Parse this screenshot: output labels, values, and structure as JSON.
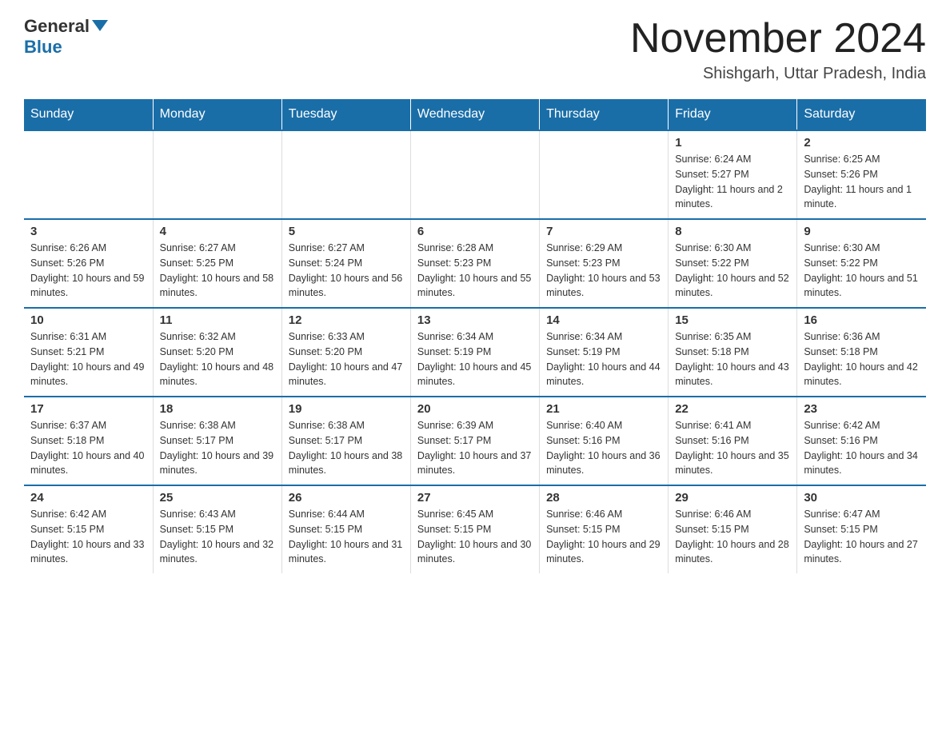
{
  "header": {
    "logo_general": "General",
    "logo_blue": "Blue",
    "month_title": "November 2024",
    "location": "Shishgarh, Uttar Pradesh, India"
  },
  "days_of_week": [
    "Sunday",
    "Monday",
    "Tuesday",
    "Wednesday",
    "Thursday",
    "Friday",
    "Saturday"
  ],
  "weeks": [
    [
      {
        "day": "",
        "info": ""
      },
      {
        "day": "",
        "info": ""
      },
      {
        "day": "",
        "info": ""
      },
      {
        "day": "",
        "info": ""
      },
      {
        "day": "",
        "info": ""
      },
      {
        "day": "1",
        "info": "Sunrise: 6:24 AM\nSunset: 5:27 PM\nDaylight: 11 hours and 2 minutes."
      },
      {
        "day": "2",
        "info": "Sunrise: 6:25 AM\nSunset: 5:26 PM\nDaylight: 11 hours and 1 minute."
      }
    ],
    [
      {
        "day": "3",
        "info": "Sunrise: 6:26 AM\nSunset: 5:26 PM\nDaylight: 10 hours and 59 minutes."
      },
      {
        "day": "4",
        "info": "Sunrise: 6:27 AM\nSunset: 5:25 PM\nDaylight: 10 hours and 58 minutes."
      },
      {
        "day": "5",
        "info": "Sunrise: 6:27 AM\nSunset: 5:24 PM\nDaylight: 10 hours and 56 minutes."
      },
      {
        "day": "6",
        "info": "Sunrise: 6:28 AM\nSunset: 5:23 PM\nDaylight: 10 hours and 55 minutes."
      },
      {
        "day": "7",
        "info": "Sunrise: 6:29 AM\nSunset: 5:23 PM\nDaylight: 10 hours and 53 minutes."
      },
      {
        "day": "8",
        "info": "Sunrise: 6:30 AM\nSunset: 5:22 PM\nDaylight: 10 hours and 52 minutes."
      },
      {
        "day": "9",
        "info": "Sunrise: 6:30 AM\nSunset: 5:22 PM\nDaylight: 10 hours and 51 minutes."
      }
    ],
    [
      {
        "day": "10",
        "info": "Sunrise: 6:31 AM\nSunset: 5:21 PM\nDaylight: 10 hours and 49 minutes."
      },
      {
        "day": "11",
        "info": "Sunrise: 6:32 AM\nSunset: 5:20 PM\nDaylight: 10 hours and 48 minutes."
      },
      {
        "day": "12",
        "info": "Sunrise: 6:33 AM\nSunset: 5:20 PM\nDaylight: 10 hours and 47 minutes."
      },
      {
        "day": "13",
        "info": "Sunrise: 6:34 AM\nSunset: 5:19 PM\nDaylight: 10 hours and 45 minutes."
      },
      {
        "day": "14",
        "info": "Sunrise: 6:34 AM\nSunset: 5:19 PM\nDaylight: 10 hours and 44 minutes."
      },
      {
        "day": "15",
        "info": "Sunrise: 6:35 AM\nSunset: 5:18 PM\nDaylight: 10 hours and 43 minutes."
      },
      {
        "day": "16",
        "info": "Sunrise: 6:36 AM\nSunset: 5:18 PM\nDaylight: 10 hours and 42 minutes."
      }
    ],
    [
      {
        "day": "17",
        "info": "Sunrise: 6:37 AM\nSunset: 5:18 PM\nDaylight: 10 hours and 40 minutes."
      },
      {
        "day": "18",
        "info": "Sunrise: 6:38 AM\nSunset: 5:17 PM\nDaylight: 10 hours and 39 minutes."
      },
      {
        "day": "19",
        "info": "Sunrise: 6:38 AM\nSunset: 5:17 PM\nDaylight: 10 hours and 38 minutes."
      },
      {
        "day": "20",
        "info": "Sunrise: 6:39 AM\nSunset: 5:17 PM\nDaylight: 10 hours and 37 minutes."
      },
      {
        "day": "21",
        "info": "Sunrise: 6:40 AM\nSunset: 5:16 PM\nDaylight: 10 hours and 36 minutes."
      },
      {
        "day": "22",
        "info": "Sunrise: 6:41 AM\nSunset: 5:16 PM\nDaylight: 10 hours and 35 minutes."
      },
      {
        "day": "23",
        "info": "Sunrise: 6:42 AM\nSunset: 5:16 PM\nDaylight: 10 hours and 34 minutes."
      }
    ],
    [
      {
        "day": "24",
        "info": "Sunrise: 6:42 AM\nSunset: 5:15 PM\nDaylight: 10 hours and 33 minutes."
      },
      {
        "day": "25",
        "info": "Sunrise: 6:43 AM\nSunset: 5:15 PM\nDaylight: 10 hours and 32 minutes."
      },
      {
        "day": "26",
        "info": "Sunrise: 6:44 AM\nSunset: 5:15 PM\nDaylight: 10 hours and 31 minutes."
      },
      {
        "day": "27",
        "info": "Sunrise: 6:45 AM\nSunset: 5:15 PM\nDaylight: 10 hours and 30 minutes."
      },
      {
        "day": "28",
        "info": "Sunrise: 6:46 AM\nSunset: 5:15 PM\nDaylight: 10 hours and 29 minutes."
      },
      {
        "day": "29",
        "info": "Sunrise: 6:46 AM\nSunset: 5:15 PM\nDaylight: 10 hours and 28 minutes."
      },
      {
        "day": "30",
        "info": "Sunrise: 6:47 AM\nSunset: 5:15 PM\nDaylight: 10 hours and 27 minutes."
      }
    ]
  ]
}
